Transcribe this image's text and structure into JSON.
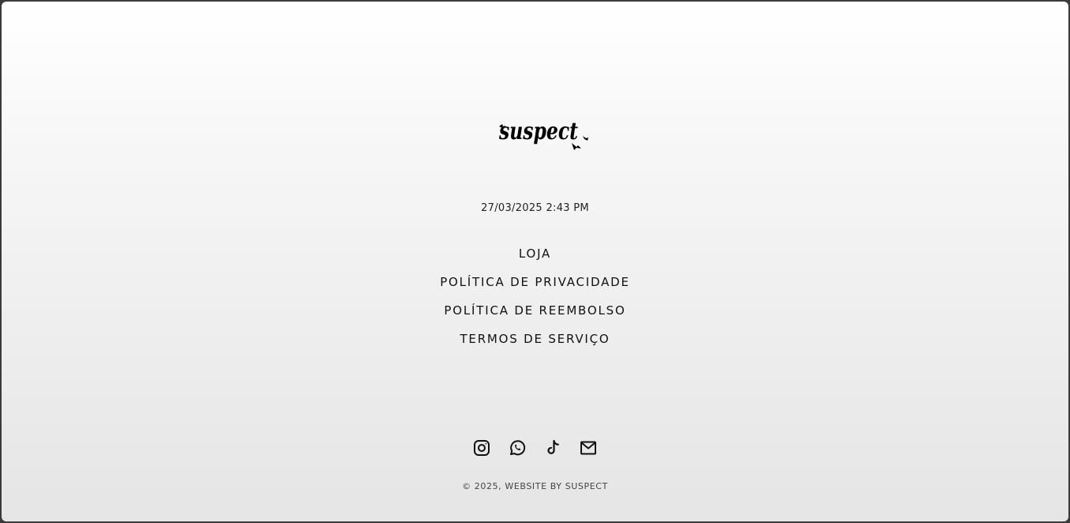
{
  "brand": {
    "logo_text": "suspect"
  },
  "footer": {
    "timestamp": "27/03/2025 2:43 PM",
    "nav": [
      {
        "label": "LOJA"
      },
      {
        "label": "POLÍTICA DE PRIVACIDADE"
      },
      {
        "label": "POLÍTICA DE REEMBOLSO"
      },
      {
        "label": "TERMOS DE SERVIÇO"
      }
    ],
    "social_icons": [
      "instagram-icon",
      "whatsapp-icon",
      "tiktok-icon",
      "email-icon"
    ],
    "copyright": "© 2025, WEBSITE BY SUSPECT"
  },
  "colors": {
    "text": "#111111",
    "frame": "#3a3a3a"
  }
}
